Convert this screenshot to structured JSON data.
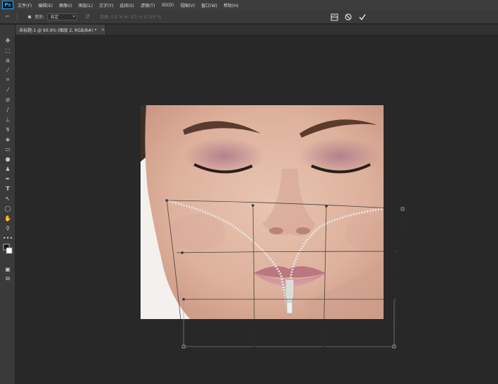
{
  "app": {
    "logo": "Ps"
  },
  "menu": [
    "文件(F)",
    "编辑(E)",
    "图像(I)",
    "图层(L)",
    "文字(Y)",
    "选择(S)",
    "滤镜(T)",
    "3D(D)",
    "视图(V)",
    "窗口(W)",
    "帮助(H)"
  ],
  "options": {
    "label": "变形:",
    "preset_value": "自定",
    "dim_text": "弯曲: 0.0 % H: 0.0 % V: 0.0 %"
  },
  "tab": {
    "title": "未标题-1 @ 90.9% (图层 2, RGB/8#) *",
    "close": "×"
  },
  "tools": [
    "move-icon",
    "marquee-icon",
    "lasso-icon",
    "magic-wand-icon",
    "crop-icon",
    "eyedropper-icon",
    "healing-icon",
    "brush-icon",
    "stamp-icon",
    "history-brush-icon",
    "eraser-icon",
    "gradient-icon",
    "blur-icon",
    "dodge-icon",
    "pen-icon",
    "type-icon",
    "path-select-icon",
    "ellipse-icon",
    "hand-icon",
    "zoom-icon",
    "more-icon",
    "colors-icon",
    "quickmask-icon",
    "screen-mode-icon"
  ],
  "colors": {
    "accent": "#31a8ff",
    "canvas": "#282828",
    "chrome": "#3a3a3a"
  }
}
